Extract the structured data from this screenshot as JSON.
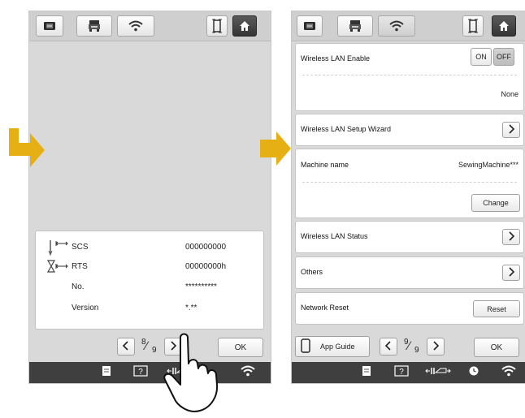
{
  "colors": {
    "arrow": "#e6b014",
    "bottombar": "#3f3f3f",
    "screen_bg": "#d9d9d9",
    "home_button": "#3f3f3f"
  },
  "left_screen": {
    "top_icons": [
      "embroidery-unit-icon",
      "machine-icon",
      "wifi-icon",
      "frame-icon",
      "home-icon"
    ],
    "info": {
      "rows": [
        {
          "icon": "needle-counter-icon",
          "label": "SCS",
          "value": "000000000"
        },
        {
          "icon": "hourglass-counter-icon",
          "label": "RTS",
          "value": "00000000h"
        },
        {
          "label": "No.",
          "value": "**********"
        },
        {
          "label": "Version",
          "value": "*.**"
        }
      ]
    },
    "page": {
      "current": "8",
      "total": "9"
    },
    "ok_label": "OK",
    "bottom_icons": [
      "settings-icon",
      "help-icon",
      "presser-foot-icon",
      "wifi-icon"
    ]
  },
  "right_screen": {
    "top_icons": [
      "embroidery-unit-icon",
      "machine-icon",
      "wifi-icon",
      "frame-icon",
      "home-icon"
    ],
    "wlan_enable": {
      "label": "Wireless LAN Enable",
      "on": "ON",
      "off": "OFF",
      "selected": "OFF",
      "network": "None"
    },
    "setup_wizard": {
      "label": "Wireless LAN Setup Wizard"
    },
    "machine_name": {
      "label": "Machine name",
      "value": "SewingMachine***",
      "change": "Change"
    },
    "wlan_status": {
      "label": "Wireless LAN Status"
    },
    "others": {
      "label": "Others"
    },
    "network_reset": {
      "label": "Network Reset",
      "button": "Reset"
    },
    "app_guide": {
      "label": "App Guide"
    },
    "page": {
      "current": "9",
      "total": "9"
    },
    "ok_label": "OK",
    "bottom_icons": [
      "settings-icon",
      "help-icon",
      "presser-foot-icon",
      "clock-icon",
      "wifi-icon"
    ]
  }
}
